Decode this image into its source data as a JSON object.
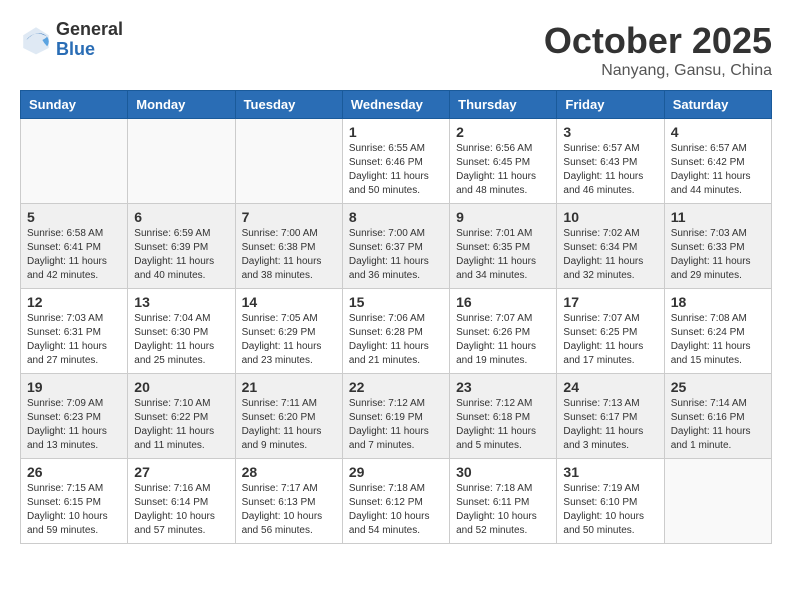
{
  "header": {
    "logo_general": "General",
    "logo_blue": "Blue",
    "month": "October 2025",
    "location": "Nanyang, Gansu, China"
  },
  "days_of_week": [
    "Sunday",
    "Monday",
    "Tuesday",
    "Wednesday",
    "Thursday",
    "Friday",
    "Saturday"
  ],
  "weeks": [
    {
      "shaded": false,
      "days": [
        {
          "num": "",
          "info": ""
        },
        {
          "num": "",
          "info": ""
        },
        {
          "num": "",
          "info": ""
        },
        {
          "num": "1",
          "info": "Sunrise: 6:55 AM\nSunset: 6:46 PM\nDaylight: 11 hours\nand 50 minutes."
        },
        {
          "num": "2",
          "info": "Sunrise: 6:56 AM\nSunset: 6:45 PM\nDaylight: 11 hours\nand 48 minutes."
        },
        {
          "num": "3",
          "info": "Sunrise: 6:57 AM\nSunset: 6:43 PM\nDaylight: 11 hours\nand 46 minutes."
        },
        {
          "num": "4",
          "info": "Sunrise: 6:57 AM\nSunset: 6:42 PM\nDaylight: 11 hours\nand 44 minutes."
        }
      ]
    },
    {
      "shaded": true,
      "days": [
        {
          "num": "5",
          "info": "Sunrise: 6:58 AM\nSunset: 6:41 PM\nDaylight: 11 hours\nand 42 minutes."
        },
        {
          "num": "6",
          "info": "Sunrise: 6:59 AM\nSunset: 6:39 PM\nDaylight: 11 hours\nand 40 minutes."
        },
        {
          "num": "7",
          "info": "Sunrise: 7:00 AM\nSunset: 6:38 PM\nDaylight: 11 hours\nand 38 minutes."
        },
        {
          "num": "8",
          "info": "Sunrise: 7:00 AM\nSunset: 6:37 PM\nDaylight: 11 hours\nand 36 minutes."
        },
        {
          "num": "9",
          "info": "Sunrise: 7:01 AM\nSunset: 6:35 PM\nDaylight: 11 hours\nand 34 minutes."
        },
        {
          "num": "10",
          "info": "Sunrise: 7:02 AM\nSunset: 6:34 PM\nDaylight: 11 hours\nand 32 minutes."
        },
        {
          "num": "11",
          "info": "Sunrise: 7:03 AM\nSunset: 6:33 PM\nDaylight: 11 hours\nand 29 minutes."
        }
      ]
    },
    {
      "shaded": false,
      "days": [
        {
          "num": "12",
          "info": "Sunrise: 7:03 AM\nSunset: 6:31 PM\nDaylight: 11 hours\nand 27 minutes."
        },
        {
          "num": "13",
          "info": "Sunrise: 7:04 AM\nSunset: 6:30 PM\nDaylight: 11 hours\nand 25 minutes."
        },
        {
          "num": "14",
          "info": "Sunrise: 7:05 AM\nSunset: 6:29 PM\nDaylight: 11 hours\nand 23 minutes."
        },
        {
          "num": "15",
          "info": "Sunrise: 7:06 AM\nSunset: 6:28 PM\nDaylight: 11 hours\nand 21 minutes."
        },
        {
          "num": "16",
          "info": "Sunrise: 7:07 AM\nSunset: 6:26 PM\nDaylight: 11 hours\nand 19 minutes."
        },
        {
          "num": "17",
          "info": "Sunrise: 7:07 AM\nSunset: 6:25 PM\nDaylight: 11 hours\nand 17 minutes."
        },
        {
          "num": "18",
          "info": "Sunrise: 7:08 AM\nSunset: 6:24 PM\nDaylight: 11 hours\nand 15 minutes."
        }
      ]
    },
    {
      "shaded": true,
      "days": [
        {
          "num": "19",
          "info": "Sunrise: 7:09 AM\nSunset: 6:23 PM\nDaylight: 11 hours\nand 13 minutes."
        },
        {
          "num": "20",
          "info": "Sunrise: 7:10 AM\nSunset: 6:22 PM\nDaylight: 11 hours\nand 11 minutes."
        },
        {
          "num": "21",
          "info": "Sunrise: 7:11 AM\nSunset: 6:20 PM\nDaylight: 11 hours\nand 9 minutes."
        },
        {
          "num": "22",
          "info": "Sunrise: 7:12 AM\nSunset: 6:19 PM\nDaylight: 11 hours\nand 7 minutes."
        },
        {
          "num": "23",
          "info": "Sunrise: 7:12 AM\nSunset: 6:18 PM\nDaylight: 11 hours\nand 5 minutes."
        },
        {
          "num": "24",
          "info": "Sunrise: 7:13 AM\nSunset: 6:17 PM\nDaylight: 11 hours\nand 3 minutes."
        },
        {
          "num": "25",
          "info": "Sunrise: 7:14 AM\nSunset: 6:16 PM\nDaylight: 11 hours\nand 1 minute."
        }
      ]
    },
    {
      "shaded": false,
      "days": [
        {
          "num": "26",
          "info": "Sunrise: 7:15 AM\nSunset: 6:15 PM\nDaylight: 10 hours\nand 59 minutes."
        },
        {
          "num": "27",
          "info": "Sunrise: 7:16 AM\nSunset: 6:14 PM\nDaylight: 10 hours\nand 57 minutes."
        },
        {
          "num": "28",
          "info": "Sunrise: 7:17 AM\nSunset: 6:13 PM\nDaylight: 10 hours\nand 56 minutes."
        },
        {
          "num": "29",
          "info": "Sunrise: 7:18 AM\nSunset: 6:12 PM\nDaylight: 10 hours\nand 54 minutes."
        },
        {
          "num": "30",
          "info": "Sunrise: 7:18 AM\nSunset: 6:11 PM\nDaylight: 10 hours\nand 52 minutes."
        },
        {
          "num": "31",
          "info": "Sunrise: 7:19 AM\nSunset: 6:10 PM\nDaylight: 10 hours\nand 50 minutes."
        },
        {
          "num": "",
          "info": ""
        }
      ]
    }
  ]
}
